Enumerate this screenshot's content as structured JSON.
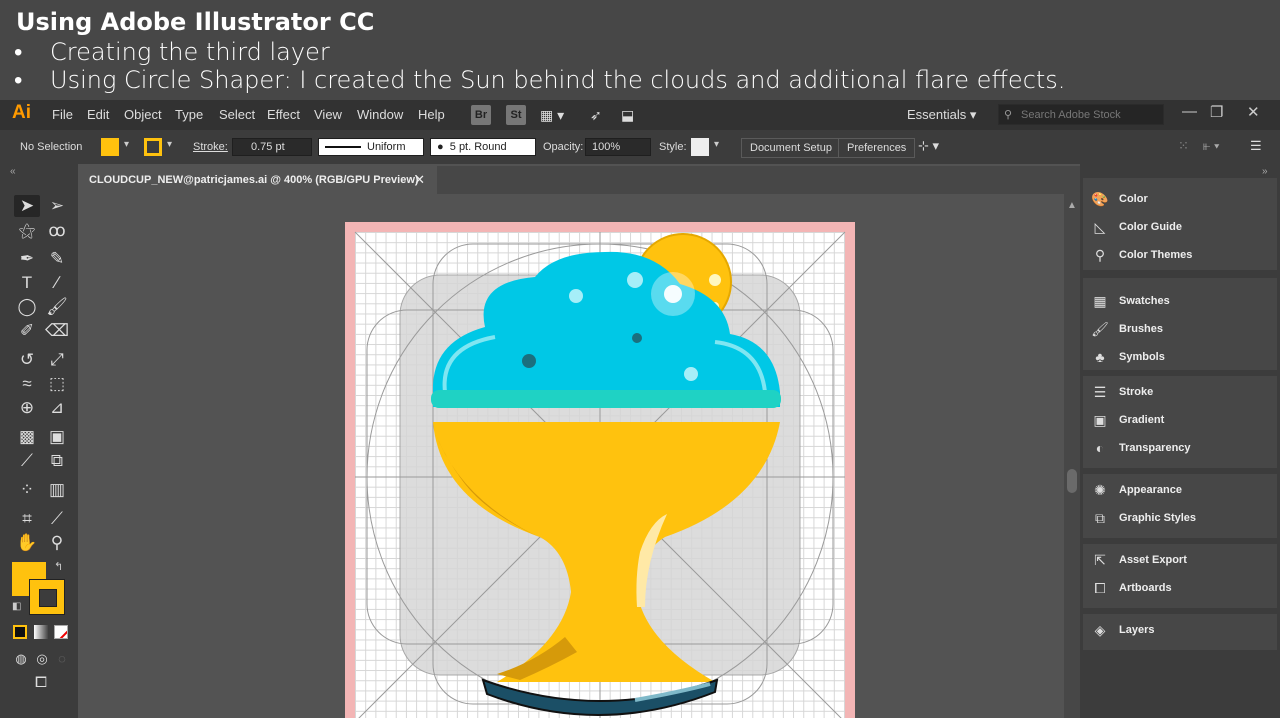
{
  "slide": {
    "title": "Using Adobe Illustrator CC",
    "bullets": [
      "Creating the third layer",
      "Using Circle Shaper: I  created the Sun behind the clouds and additional flare effects."
    ],
    "bullet_symbol": "•"
  },
  "app": {
    "logo": "Ai",
    "menu": [
      "File",
      "Edit",
      "Object",
      "Type",
      "Select",
      "Effect",
      "View",
      "Window",
      "Help"
    ],
    "bridge_label": "Br",
    "stock_label": "St",
    "workspace": "Essentials",
    "search_placeholder": "Search Adobe Stock",
    "window_controls": [
      "—",
      "❐",
      "✕"
    ]
  },
  "control_bar": {
    "selection_status": "No Selection",
    "stroke_label": "Stroke:",
    "stroke_weight": "0.75 pt",
    "stroke_profile": "Uniform",
    "brush": "5 pt. Round",
    "opacity_label": "Opacity:",
    "opacity_value": "100%",
    "style_label": "Style:",
    "document_setup": "Document Setup",
    "preferences": "Preferences",
    "fill_color": "#ffc20e",
    "stroke_color": "#ffc20e"
  },
  "document": {
    "tab_title": "CLOUDCUP_NEW@patricjames.ai @ 400% (RGB/GPU Preview)",
    "close_symbol": "✕"
  },
  "artwork_colors": {
    "cup": "#ffc20e",
    "cup_shadow": "#d69a0a",
    "cloud": "#00c8e6",
    "cloud_rim": "#1fd2c4",
    "sun": "#ffc20e",
    "base": "#1b4f66"
  },
  "panels": {
    "group1": [
      "Color",
      "Color Guide",
      "Color Themes"
    ],
    "group2": [
      "Swatches",
      "Brushes",
      "Symbols"
    ],
    "group3": [
      "Stroke",
      "Gradient",
      "Transparency"
    ],
    "group4": [
      "Appearance",
      "Graphic Styles"
    ],
    "group5": [
      "Asset Export",
      "Artboards"
    ],
    "group6": [
      "Layers"
    ]
  }
}
